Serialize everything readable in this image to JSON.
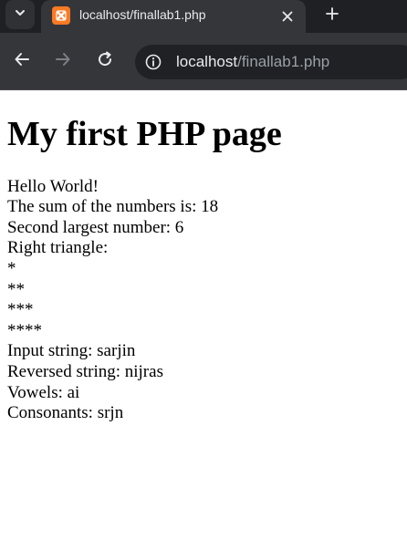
{
  "browser": {
    "tab": {
      "title": "localhost/finallab1.php",
      "favicon": "xampp-icon"
    },
    "url": {
      "host": "localhost",
      "path": "/finallab1.php"
    }
  },
  "page": {
    "heading": "My first PHP page",
    "lines": [
      "Hello World!",
      "The sum of the numbers is: 18",
      "Second largest number: 6",
      "Right triangle:",
      "*",
      "**",
      "***",
      "****",
      "Input string: sarjin",
      "Reversed string: nijras",
      "Vowels: ai",
      "Consonants: srjn"
    ]
  },
  "colors": {
    "chrome_bg": "#202124",
    "tab_bg": "#35363a",
    "favicon": "#fb7a24",
    "page_bg": "#ffffff"
  }
}
